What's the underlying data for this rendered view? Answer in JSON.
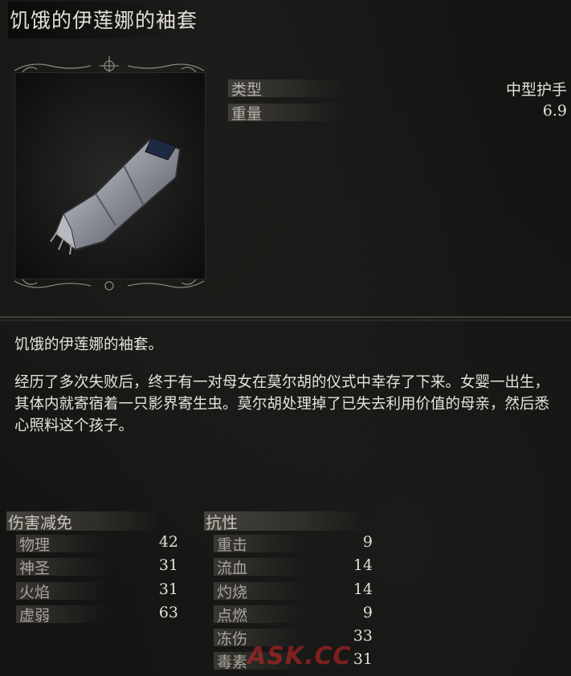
{
  "item": {
    "name": "饥饿的伊莲娜的袖套",
    "image": "gauntlet-icon"
  },
  "stats": [
    {
      "label": "类型",
      "value": "中型护手"
    },
    {
      "label": "重量",
      "value": "6.9"
    }
  ],
  "description": {
    "line1": "饥饿的伊莲娜的袖套。",
    "line2": "经历了多次失败后，终于有一对母女在莫尔胡的仪式中幸存了下来。女婴一出生，其体内就寄宿着一只影界寄生虫。莫尔胡处理掉了已失去利用价值的母亲，然后悉心照料这个孩子。"
  },
  "damage_negation": {
    "header": "伤害减免",
    "rows": [
      {
        "label": "物理",
        "value": "42"
      },
      {
        "label": "神圣",
        "value": "31"
      },
      {
        "label": "火焰",
        "value": "31"
      },
      {
        "label": "虚弱",
        "value": "63"
      }
    ]
  },
  "resistance": {
    "header": "抗性",
    "rows": [
      {
        "label": "重击",
        "value": "9"
      },
      {
        "label": "流血",
        "value": "14"
      },
      {
        "label": "灼烧",
        "value": "14"
      },
      {
        "label": "点燃",
        "value": "9"
      },
      {
        "label": "冻伤",
        "value": "33"
      },
      {
        "label": "毒素",
        "value": "31"
      }
    ]
  },
  "watermark": "ASK.CC",
  "colors": {
    "background": "#141413",
    "text": "#d6d3cb",
    "watermark": "#d22828"
  }
}
